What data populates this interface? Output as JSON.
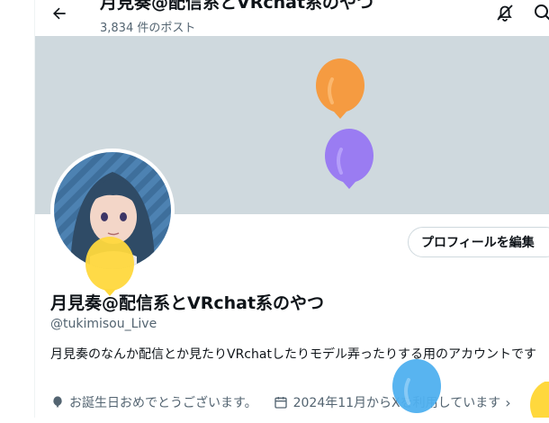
{
  "header": {
    "title": "月見奏@配信系とVRchat系のやつ",
    "post_count": "3,834 件のポスト"
  },
  "icons": {
    "back": "arrow-left-icon",
    "notify_off": "bell-slash-icon",
    "search": "search-icon",
    "birthday": "balloon-icon",
    "joined": "calendar-icon",
    "chevron": "chevron-right-icon"
  },
  "profile": {
    "edit_button": "プロフィールを編集",
    "display_name": "月見奏@配信系とVRchat系のやつ",
    "handle": "@tukimisou_Live",
    "bio": "月見奏のなんか配信とか見たりVRchatしたりモデル弄ったりする用のアカウントです",
    "birthday_text": "お誕生日おめでとうございます。",
    "joined_text": "2024年11月からXを利用しています",
    "chevron": "›"
  },
  "colors": {
    "banner": "#cfd9de",
    "text_primary": "#0f1419",
    "text_secondary": "#536471",
    "balloon_orange": "#f59b41",
    "balloon_purple": "#9a7cf2",
    "balloon_yellow": "#ffd83d",
    "balloon_blue": "#4fb0ef"
  }
}
